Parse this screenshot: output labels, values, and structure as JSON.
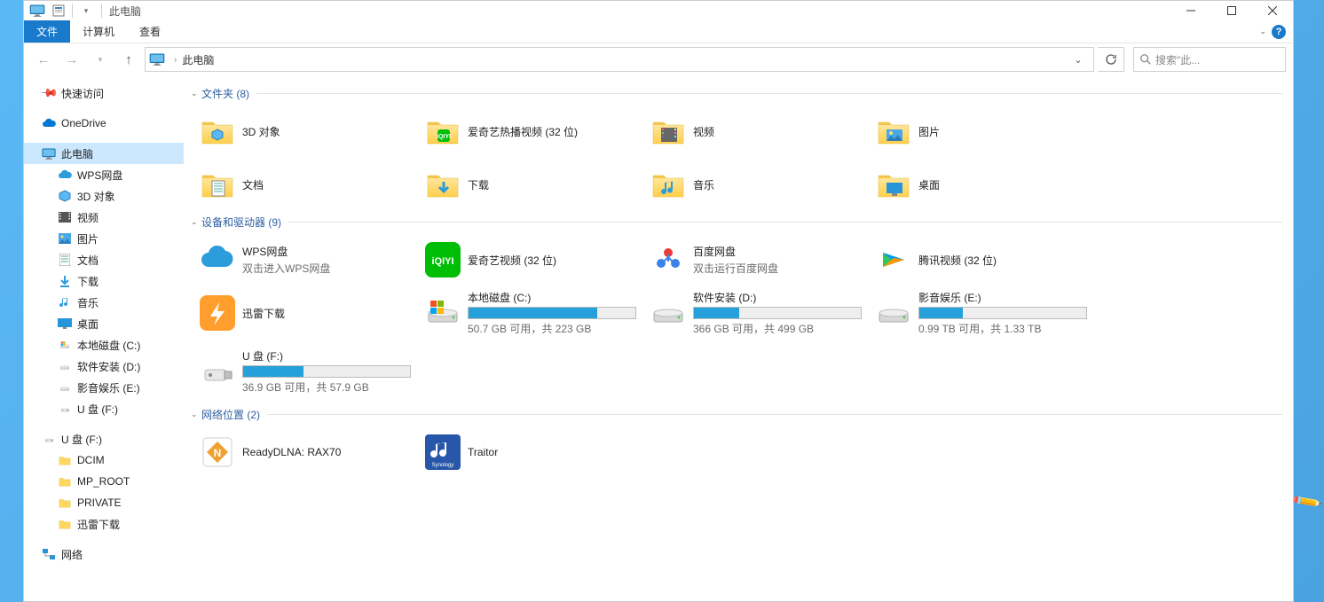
{
  "window": {
    "title": "此电脑"
  },
  "ribbon": {
    "file": "文件",
    "computer": "计算机",
    "view": "查看"
  },
  "address": {
    "location": "此电脑",
    "search_placeholder": "搜索\"此..."
  },
  "sidebar": {
    "quick_access": "快速访问",
    "onedrive": "OneDrive",
    "this_pc": "此电脑",
    "wps": "WPS网盘",
    "obj3d": "3D 对象",
    "videos": "视频",
    "pictures": "图片",
    "documents": "文档",
    "downloads": "下载",
    "music": "音乐",
    "desktop": "桌面",
    "drive_c": "本地磁盘 (C:)",
    "drive_d": "软件安装 (D:)",
    "drive_e": "影音娱乐 (E:)",
    "drive_f": "U 盘 (F:)",
    "usb_f": "U 盘 (F:)",
    "dcim": "DCIM",
    "mp_root": "MP_ROOT",
    "private": "PRIVATE",
    "xunlei": "迅雷下载",
    "network": "网络"
  },
  "groups": {
    "folders": "文件夹 (8)",
    "devices": "设备和驱动器 (9)",
    "network": "网络位置 (2)"
  },
  "folders": {
    "obj3d": "3D 对象",
    "iqiyi_hot": "爱奇艺热播视频 (32 位)",
    "videos": "视频",
    "pictures": "图片",
    "documents": "文档",
    "downloads": "下载",
    "music": "音乐",
    "desktop": "桌面"
  },
  "devices": {
    "wps": {
      "name": "WPS网盘",
      "sub": "双击进入WPS网盘"
    },
    "iqiyi": {
      "name": "爱奇艺视频 (32 位)"
    },
    "baidu": {
      "name": "百度网盘",
      "sub": "双击运行百度网盘"
    },
    "tencent": {
      "name": "腾讯视频 (32 位)"
    },
    "xunlei": {
      "name": "迅雷下载"
    },
    "drive_c": {
      "name": "本地磁盘 (C:)",
      "info": "50.7 GB 可用，共 223 GB",
      "pct": 77
    },
    "drive_d": {
      "name": "软件安装 (D:)",
      "info": "366 GB 可用，共 499 GB",
      "pct": 27
    },
    "drive_e": {
      "name": "影音娱乐 (E:)",
      "info": "0.99 TB 可用，共 1.33 TB",
      "pct": 26
    },
    "drive_f": {
      "name": "U 盘 (F:)",
      "info": "36.9 GB 可用，共 57.9 GB",
      "pct": 36
    }
  },
  "netloc": {
    "ready": "ReadyDLNA: RAX70",
    "traitor": "Traitor"
  }
}
